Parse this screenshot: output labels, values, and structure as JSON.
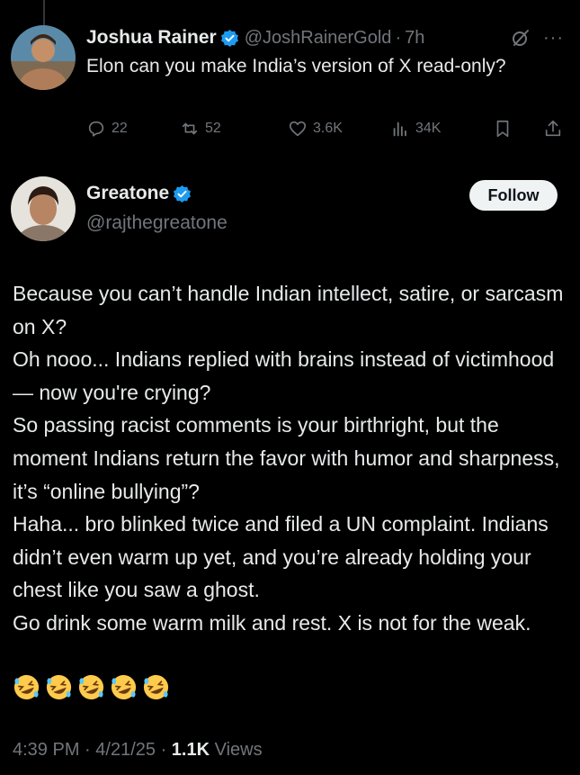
{
  "parent": {
    "name": "Joshua Rainer",
    "handle": "@JoshRainerGold",
    "separator": "·",
    "time": "7h",
    "text": "Elon can you make India’s version of X read-only?",
    "replies": "22",
    "reposts": "52",
    "likes": "3.6K",
    "views": "34K"
  },
  "reply": {
    "name": "Greatone",
    "handle": "@rajthegreatone",
    "follow_label": "Follow",
    "paragraphs": [
      "Because you can’t handle Indian intellect, satire, or sarcasm on X?",
      "Oh nooo... Indians replied with brains instead of victimhood — now you're crying?",
      "So passing racist comments is your birthright, but the moment Indians return the favor with humor and sharpness, it’s “online bullying”?",
      "Haha... bro blinked twice and filed a UN complaint. Indians didn’t even warm up yet, and you’re already holding your chest like you saw a ghost.",
      "Go drink some warm milk and rest. X is not for the weak."
    ],
    "emoji_count": 5,
    "emoji_name": "rolling-on-the-floor-laughing",
    "time": "4:39 PM",
    "date": "4/21/25",
    "views_count": "1.1K",
    "views_label": "Views"
  },
  "colors": {
    "background": "#000000",
    "text": "#e7e9ea",
    "secondary": "#71767b",
    "verified": "#1d9bf0",
    "follow_bg": "#eff3f4"
  }
}
